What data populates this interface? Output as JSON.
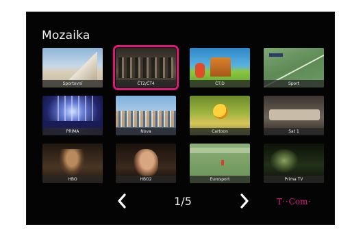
{
  "page": {
    "title": "Mozaika"
  },
  "channels": [
    {
      "label": "Sportovní",
      "icon": "stadium-thumbnail",
      "selected": false
    },
    {
      "label": "ČT2/ČT4",
      "icon": "crowd-thumbnail",
      "selected": true
    },
    {
      "label": "ČT:D",
      "icon": "cartoon-thumbnail",
      "selected": false
    },
    {
      "label": "Sport",
      "icon": "field-thumbnail",
      "selected": false
    },
    {
      "label": "PRIMA",
      "icon": "stage-thumbnail",
      "selected": false
    },
    {
      "label": "Nova",
      "icon": "crowd-thumbnail",
      "selected": false
    },
    {
      "label": "Cartoon",
      "icon": "cartoon-thumbnail",
      "selected": false
    },
    {
      "label": "Sat 1",
      "icon": "car-thumbnail",
      "selected": false
    },
    {
      "label": "HBO",
      "icon": "movie-thumbnail",
      "selected": false
    },
    {
      "label": "HBO2",
      "icon": "movie-thumbnail",
      "selected": false
    },
    {
      "label": "Eurosport",
      "icon": "field-thumbnail",
      "selected": false
    },
    {
      "label": "Prima TV",
      "icon": "night-thumbnail",
      "selected": false
    }
  ],
  "pager": {
    "prev_icon": "chevron-left-icon",
    "next_icon": "chevron-right-icon",
    "page_indicator": "1/5"
  },
  "brand": {
    "t_mark": "T",
    "dots": "··",
    "name": "Com·"
  },
  "colors": {
    "background": "#040405",
    "selection": "#e3177a",
    "brand": "#d91b7e"
  }
}
